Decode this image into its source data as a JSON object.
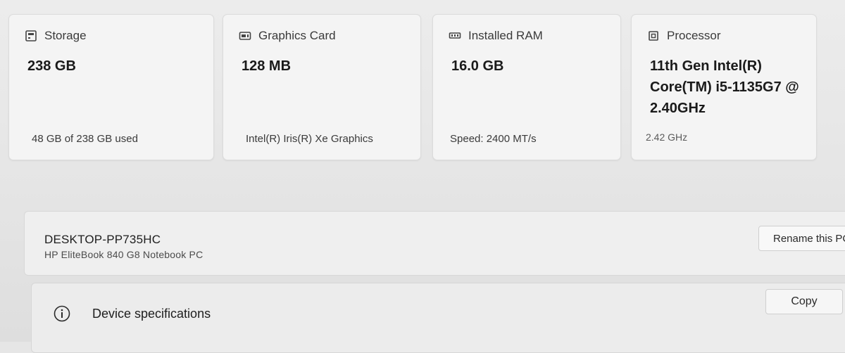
{
  "cards": [
    {
      "icon": "storage-icon",
      "label": "Storage",
      "value": "238 GB",
      "detail": "48 GB of 238 GB used"
    },
    {
      "icon": "graphics-card-icon",
      "label": "Graphics Card",
      "value": "128 MB",
      "detail": "Intel(R) Iris(R) Xe Graphics"
    },
    {
      "icon": "ram-icon",
      "label": "Installed RAM",
      "value": "16.0 GB",
      "detail": "Speed: 2400 MT/s"
    },
    {
      "icon": "processor-icon",
      "label": "Processor",
      "value": "11th Gen Intel(R) Core(TM) i5-1135G7 @ 2.40GHz",
      "detail": "2.42 GHz"
    }
  ],
  "device": {
    "name": "DESKTOP-PP735HC",
    "model": "HP EliteBook 840 G8 Notebook PC",
    "rename_label": "Rename this PC"
  },
  "specs": {
    "icon": "info-icon",
    "title": "Device specifications",
    "copy_label": "Copy"
  }
}
